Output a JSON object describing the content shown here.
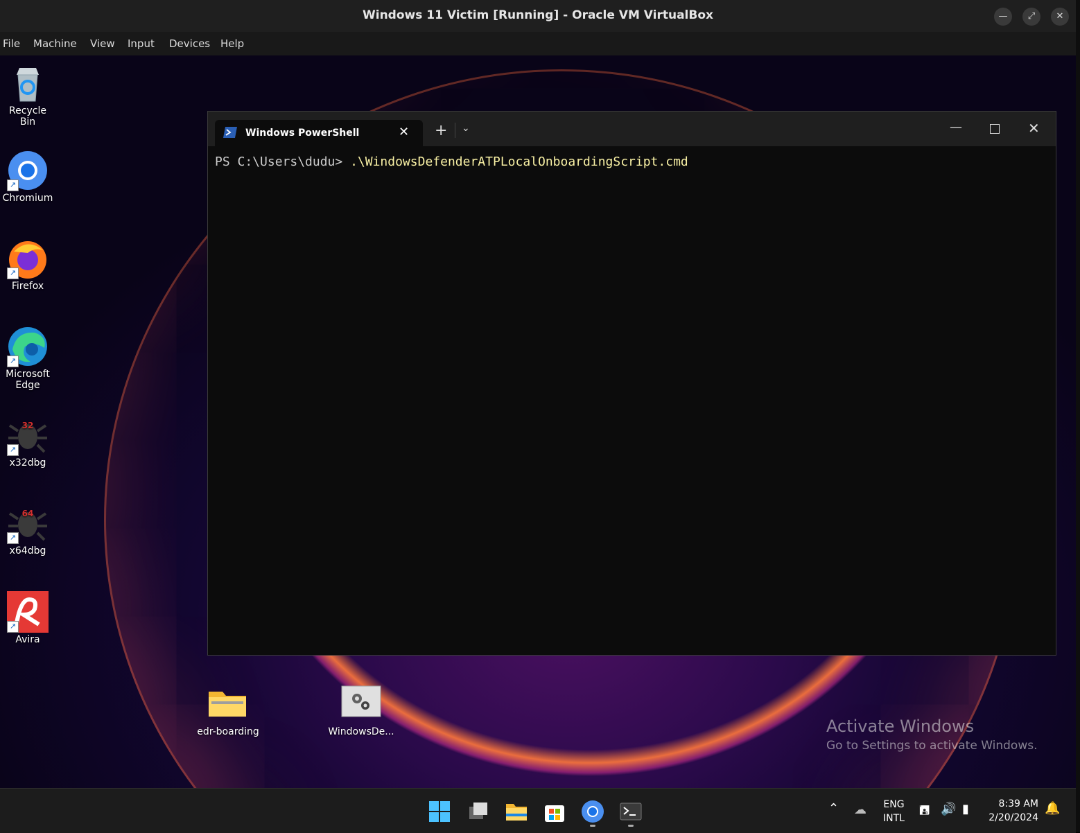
{
  "window": {
    "title": "Windows 11 Victim [Running] - Oracle VM VirtualBox",
    "minimize_icon": "minimize-icon",
    "restore_icon": "restore-icon",
    "close_icon": "close-icon"
  },
  "menubar": {
    "items": [
      "File",
      "Machine",
      "View",
      "Input",
      "Devices",
      "Help"
    ]
  },
  "desktop": {
    "icons": [
      {
        "label": "Recycle Bin",
        "icon": "recycle-bin-icon"
      },
      {
        "label": "Chromium",
        "icon": "chromium-icon"
      },
      {
        "label": "Firefox",
        "icon": "firefox-icon"
      },
      {
        "label": "Microsoft Edge",
        "icon": "edge-icon"
      },
      {
        "label": "x32dbg",
        "icon": "bug-icon",
        "badge": "32"
      },
      {
        "label": "x64dbg",
        "icon": "bug-icon",
        "badge": "64"
      },
      {
        "label": "Avira",
        "icon": "avira-icon"
      },
      {
        "label": "edr-boarding",
        "icon": "zip-folder-icon"
      },
      {
        "label": "WindowsDe...",
        "icon": "settings-file-icon"
      }
    ],
    "activate": {
      "title": "Activate Windows",
      "subtitle": "Go to Settings to activate Windows."
    }
  },
  "powershell": {
    "tab_label": "Windows PowerShell",
    "prompt": "PS C:\\Users\\dudu> ",
    "command": ".\\WindowsDefenderATPLocalOnboardingScript.cmd"
  },
  "taskbar": {
    "lang1": "ENG",
    "lang2": "INTL",
    "time": "8:39 AM",
    "date": "2/20/2024"
  }
}
